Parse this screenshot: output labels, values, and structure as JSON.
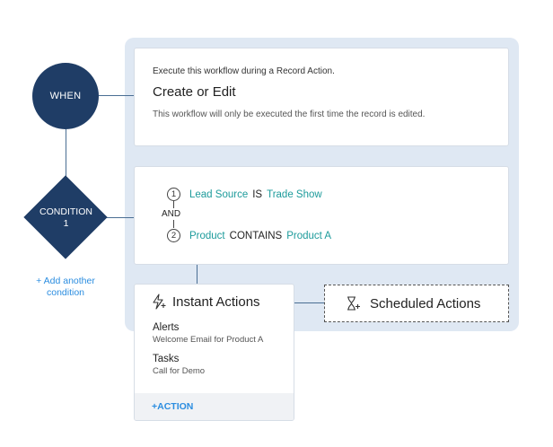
{
  "flow": {
    "when_node": {
      "label": "WHEN"
    },
    "condition_node": {
      "label_line1": "CONDITION",
      "label_line2": "1"
    },
    "add_condition": {
      "line1": "+ Add another",
      "line2": "condition"
    }
  },
  "when_card": {
    "description": "Execute this workflow during a Record Action.",
    "title": "Create or Edit",
    "note": "This workflow will only be executed the first time the record is edited."
  },
  "conditions": {
    "joiner": "AND",
    "rows": [
      {
        "number": "1",
        "field": "Lead Source",
        "operator": "IS",
        "value": "Trade Show"
      },
      {
        "number": "2",
        "field": "Product",
        "operator": "CONTAINS",
        "value": "Product A"
      }
    ]
  },
  "instant_actions": {
    "title": "Instant Actions",
    "icon": "instant-actions-icon",
    "sections": [
      {
        "label": "Alerts",
        "value": "Welcome Email for Product A"
      },
      {
        "label": "Tasks",
        "value": "Call for Demo"
      }
    ],
    "action_label": "+ACTION"
  },
  "scheduled_actions": {
    "title": "Scheduled Actions",
    "icon": "hourglass-plus-icon"
  },
  "colors": {
    "node_navy": "#1f3d66",
    "teal": "#1d9b9b",
    "link_blue": "#2b8de0",
    "panel_bg": "#dfe8f3"
  }
}
